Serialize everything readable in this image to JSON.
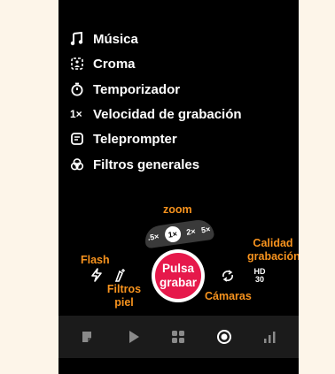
{
  "menu": {
    "items": [
      {
        "label": "Música",
        "icon": "music-note-icon"
      },
      {
        "label": "Croma",
        "icon": "chroma-icon"
      },
      {
        "label": "Temporizador",
        "icon": "timer-icon"
      },
      {
        "label": "Velocidad de grabación",
        "icon_text": "1×",
        "icon": "speed-icon"
      },
      {
        "label": "Teleprompter",
        "icon": "teleprompter-icon"
      },
      {
        "label": "Filtros generales",
        "icon": "filters-icon"
      }
    ]
  },
  "annotations": {
    "zoom": "zoom",
    "flash": "Flash",
    "skin_filters": "Filtros piel",
    "cameras": "Cámaras",
    "quality": "Calidad grabación"
  },
  "zoom": {
    "options": [
      ".5×",
      "1×",
      "2×",
      "5×"
    ],
    "selected": "1×"
  },
  "record_button": "Pulsa grabar",
  "quality_badge": {
    "line1": "HD",
    "line2": "30"
  },
  "tabs": [
    {
      "icon": "sticker-icon"
    },
    {
      "icon": "play-icon"
    },
    {
      "icon": "grid-icon"
    },
    {
      "icon": "record-icon",
      "active": true
    },
    {
      "icon": "stats-icon"
    }
  ],
  "colors": {
    "accent_orange": "#f7931e",
    "record_red": "#e6194b",
    "background_cream": "#fdf5e9",
    "tabbar": "#1b1b1b"
  }
}
